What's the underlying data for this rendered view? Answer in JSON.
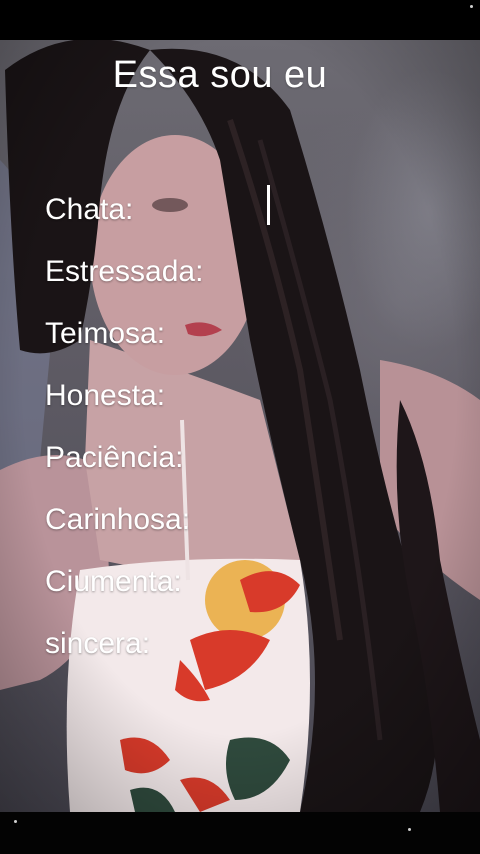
{
  "title": "Essa sou eu",
  "traits": [
    {
      "label": "Chata:"
    },
    {
      "label": "Estressada:"
    },
    {
      "label": "Teimosa:"
    },
    {
      "label": "Honesta:"
    },
    {
      "label": "Paciência:"
    },
    {
      "label": "Carinhosa:"
    },
    {
      "label": "Ciumenta:"
    },
    {
      "label": "sincera:"
    }
  ],
  "colors": {
    "text": "#ffffff",
    "letterbox": "#000000",
    "background_wall": "#6d6b73",
    "hair": "#1a1416",
    "dress_base": "#f3e9ea",
    "flower_red": "#d83a2a",
    "flower_yellow": "#e9a93a",
    "leaf_green": "#2f4a3d"
  }
}
